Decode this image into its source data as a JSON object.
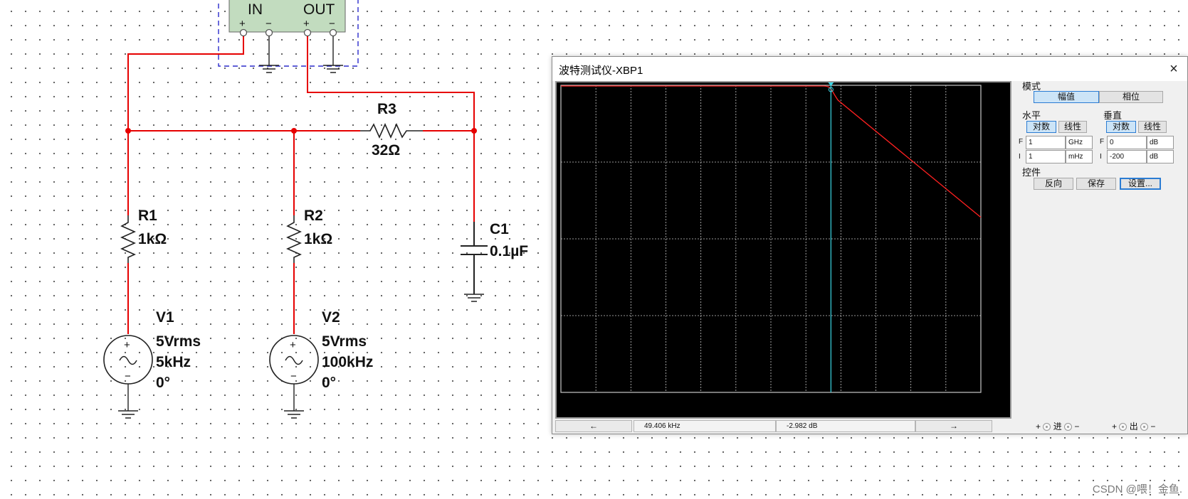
{
  "schematic": {
    "bode_block": {
      "in_label": "IN",
      "out_label": "OUT",
      "plus": "+",
      "minus": "−"
    },
    "r3": {
      "name": "R3",
      "value": "32Ω"
    },
    "r1": {
      "name": "R1",
      "value": "1kΩ"
    },
    "r2": {
      "name": "R2",
      "value": "1kΩ"
    },
    "c1": {
      "name": "C1",
      "value": "0.1µF"
    },
    "v1": {
      "name": "V1",
      "amplitude": "5Vrms",
      "frequency": "5kHz",
      "phase": "0°"
    },
    "v2": {
      "name": "V2",
      "amplitude": "5Vrms",
      "frequency": "100kHz",
      "phase": "0°"
    },
    "source_plus": "+",
    "source_minus": "−",
    "wire_color": "#e60000"
  },
  "bode_window": {
    "title": "波特测试仪-XBP1",
    "close_glyph": "×",
    "mode": {
      "label": "模式",
      "magnitude": "幅值",
      "phase": "相位",
      "selected": "magnitude"
    },
    "horizontal": {
      "label": "水平",
      "log": "对数",
      "linear": "线性",
      "selected": "log",
      "f_tag": "F",
      "f_value": "1",
      "f_unit": "GHz",
      "i_tag": "I",
      "i_value": "1",
      "i_unit": "mHz"
    },
    "vertical": {
      "label": "垂直",
      "log": "对数",
      "linear": "线性",
      "selected": "log",
      "f_tag": "F",
      "f_value": "0",
      "f_unit": "dB",
      "i_tag": "I",
      "i_value": "-200",
      "i_unit": "dB"
    },
    "controls": {
      "label": "控件",
      "reverse": "反向",
      "save": "保存",
      "settings": "设置..."
    },
    "status": {
      "left_arrow": "←",
      "right_arrow": "→",
      "frequency_readout": "49.406 kHz",
      "gain_readout": "-2.982 dB"
    },
    "terminals": {
      "in_label": "进",
      "out_label": "出",
      "plus": "+",
      "minus": "−"
    },
    "plot": {
      "background": "#000000",
      "grid_color": "#c8c8c8",
      "trace_color": "#ff2020",
      "cursor_color": "#3ad6e6",
      "cursor_fraction": 0.643,
      "trace_breakpoint_fraction": 0.625,
      "trace_end_fraction_from_top": 0.43
    }
  },
  "watermark": "CSDN @喂！金鱼."
}
